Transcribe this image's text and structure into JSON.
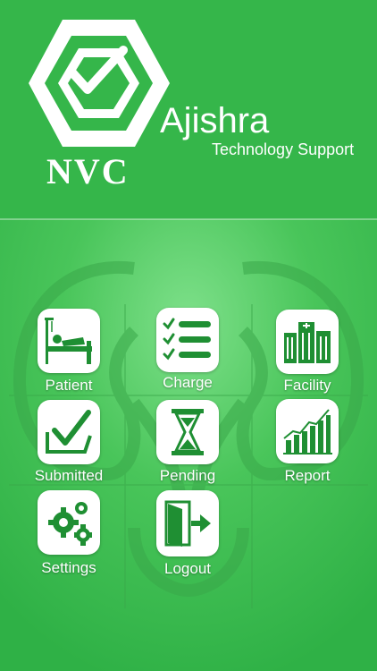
{
  "brand": {
    "logo_text": "NVC",
    "company": "Ajishra",
    "tagline": "Technology Support"
  },
  "menu": {
    "items": [
      {
        "label": "Patient",
        "icon": "patient-bed-icon"
      },
      {
        "label": "Charge",
        "icon": "checklist-icon"
      },
      {
        "label": "Facility",
        "icon": "hospital-building-icon"
      },
      {
        "label": "Submitted",
        "icon": "check-box-icon"
      },
      {
        "label": "Pending",
        "icon": "hourglass-icon"
      },
      {
        "label": "Report",
        "icon": "bar-chart-icon"
      },
      {
        "label": "Settings",
        "icon": "gears-icon"
      },
      {
        "label": "Logout",
        "icon": "exit-door-icon"
      }
    ]
  },
  "colors": {
    "primary_green": "#35b64a",
    "icon_green": "#1f8f33",
    "tile": "#ffffff"
  }
}
